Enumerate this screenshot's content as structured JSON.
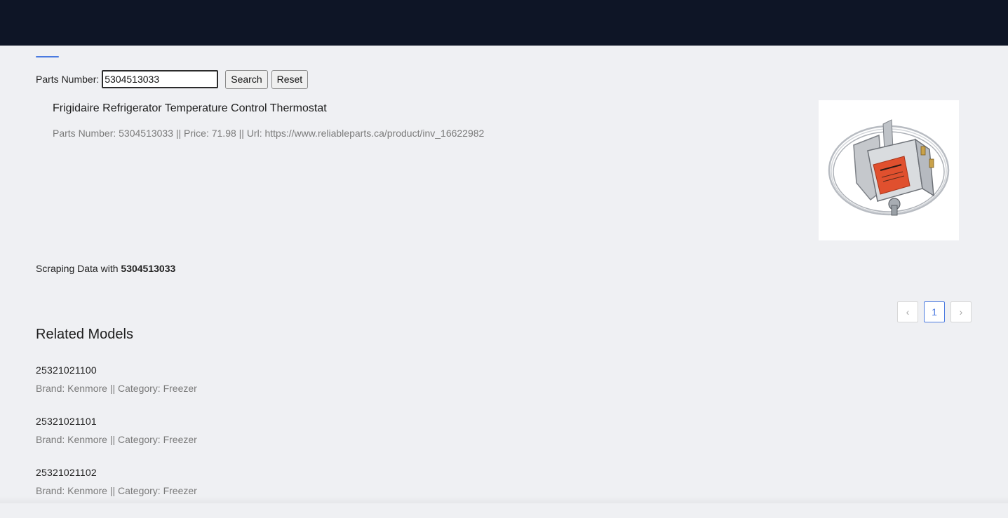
{
  "search": {
    "label": "Parts Number:",
    "value": "5304513033",
    "search_button": "Search",
    "reset_button": "Reset"
  },
  "product": {
    "title": "Frigidaire Refrigerator Temperature Control Thermostat",
    "meta": "Parts Number: 5304513033 || Price: 71.98 || Url: https://www.reliableparts.ca/product/inv_16622982"
  },
  "scraping": {
    "prefix": "Scraping Data with",
    "part": "5304513033"
  },
  "pagination": {
    "prev_icon": "‹",
    "current_page": "1",
    "next_icon": "›"
  },
  "related": {
    "title": "Related Models",
    "models": [
      {
        "number": "25321021100",
        "meta": "Brand: Kenmore || Category: Freezer"
      },
      {
        "number": "25321021101",
        "meta": "Brand: Kenmore || Category: Freezer"
      },
      {
        "number": "25321021102",
        "meta": "Brand: Kenmore || Category: Freezer"
      }
    ]
  },
  "colors": {
    "header_bg": "#0e1526",
    "page_bg": "#eff0f3",
    "accent": "#4a7ae0",
    "label_red": "#e0502e"
  }
}
